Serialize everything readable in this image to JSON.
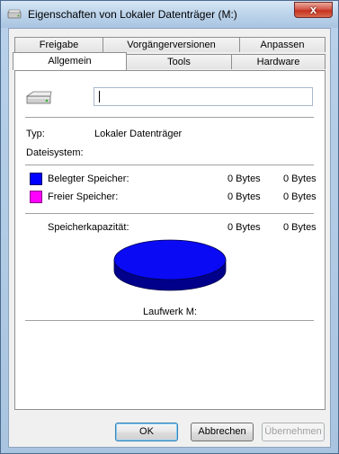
{
  "window": {
    "title": "Eigenschaften von Lokaler Datenträger (M:)",
    "close_glyph": "x"
  },
  "tabs": {
    "row_back": [
      "Freigabe",
      "Vorgängerversionen",
      "Anpassen"
    ],
    "row_front": [
      "Allgemein",
      "Tools",
      "Hardware"
    ],
    "active": "Allgemein"
  },
  "general": {
    "drive_name_value": "",
    "type_label": "Typ:",
    "type_value": "Lokaler Datenträger",
    "filesystem_label": "Dateisystem:",
    "filesystem_value": "",
    "used_label": "Belegter Speicher:",
    "used_bytes": "0 Bytes",
    "used_bytes_2": "0 Bytes",
    "free_label": "Freier Speicher:",
    "free_bytes": "0 Bytes",
    "free_bytes_2": "0 Bytes",
    "capacity_label": "Speicherkapazität:",
    "capacity_bytes": "0 Bytes",
    "capacity_bytes_2": "0 Bytes",
    "drive_label": "Laufwerk M:"
  },
  "colors": {
    "used": "#0000ff",
    "free": "#ff00ff",
    "pie_top": "#0a0af5",
    "pie_side": "#00008b"
  },
  "buttons": {
    "ok": "OK",
    "cancel": "Abbrechen",
    "apply": "Übernehmen"
  },
  "icons": {
    "window_icon": "drive-icon",
    "drive_icon": "hard-drive-icon"
  }
}
